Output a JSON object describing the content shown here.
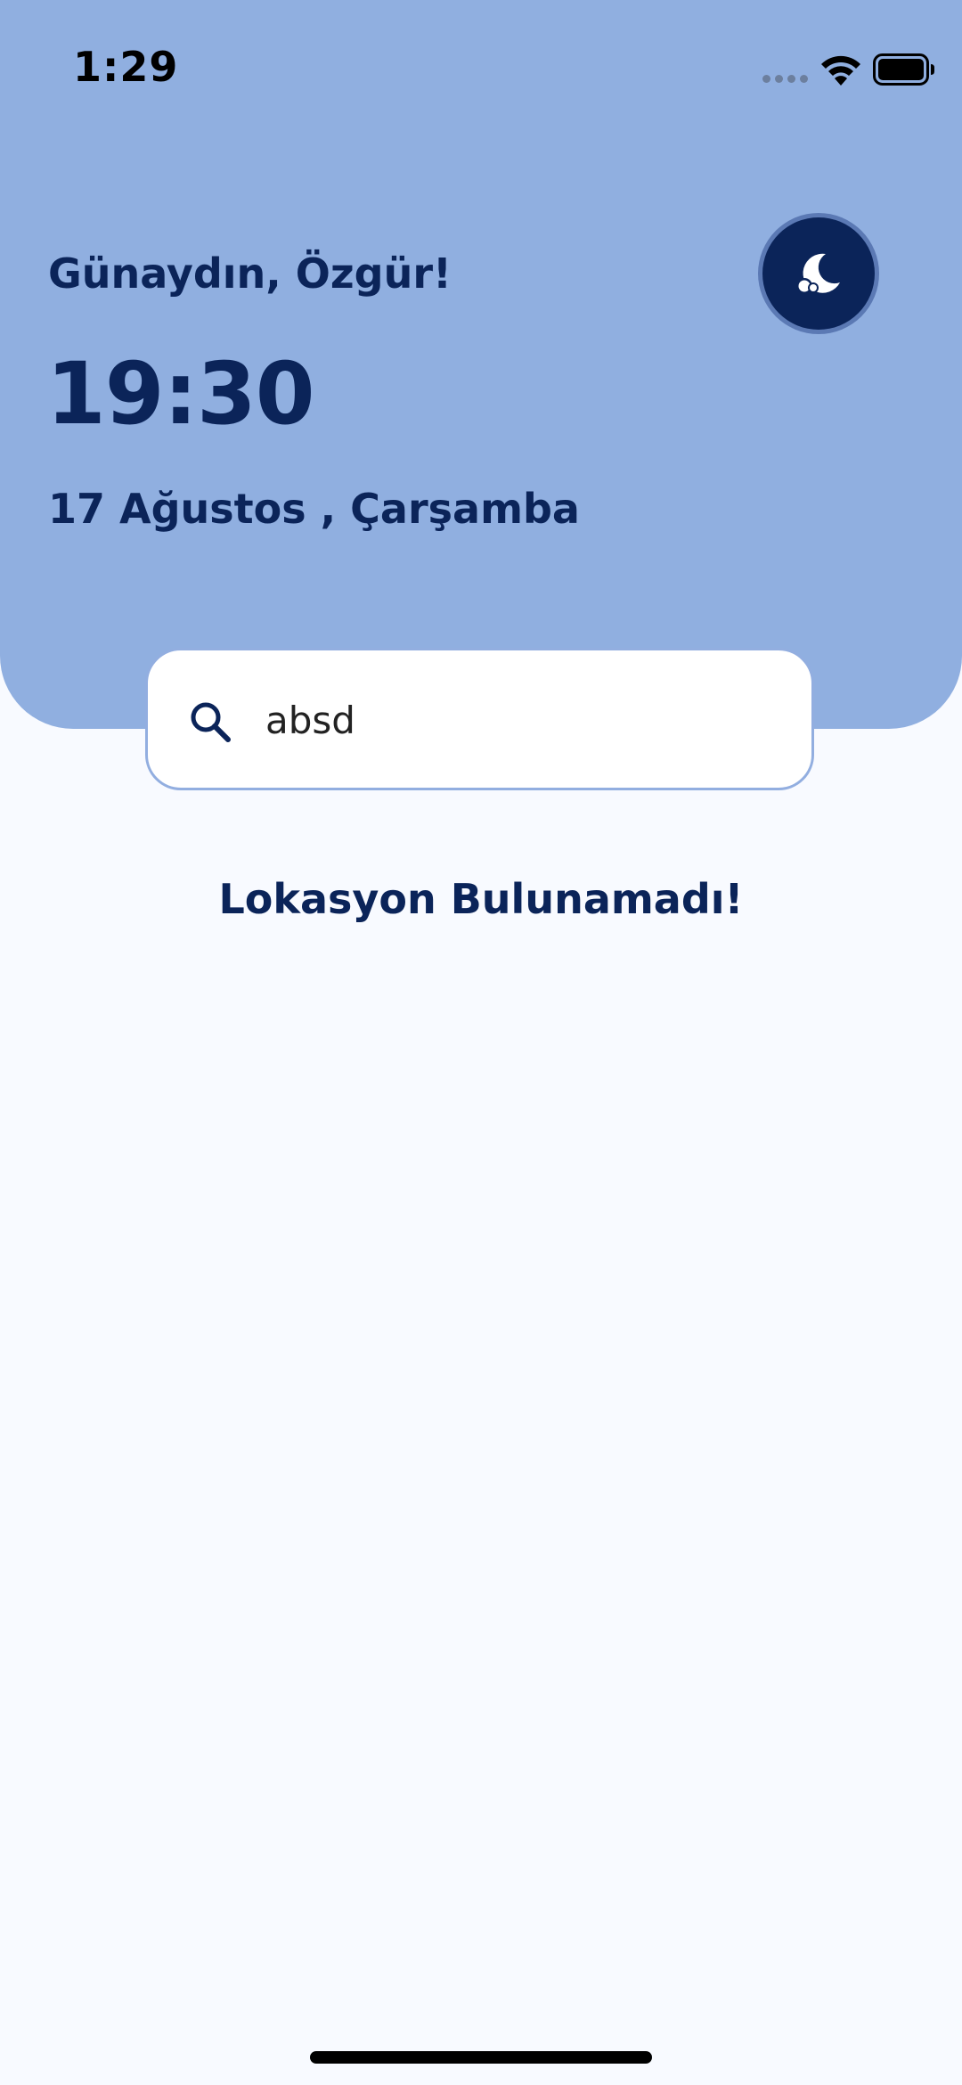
{
  "status_bar": {
    "time": "1:29",
    "icons": [
      "signal-dots-icon",
      "wifi-icon",
      "battery-icon"
    ]
  },
  "header": {
    "greeting": "Günaydın, Özgür!",
    "time": "19:30",
    "date": "17 Ağustos , Çarşamba",
    "theme_toggle_icon": "moon-cloud-icon"
  },
  "search": {
    "icon": "search-icon",
    "value": "absd"
  },
  "results": {
    "empty_message": "Lokasyon Bulunamadı!"
  },
  "colors": {
    "header_background": "#90afe0",
    "page_background": "#f8faff",
    "accent_navy": "#0b2459",
    "search_border": "#92aee0"
  }
}
